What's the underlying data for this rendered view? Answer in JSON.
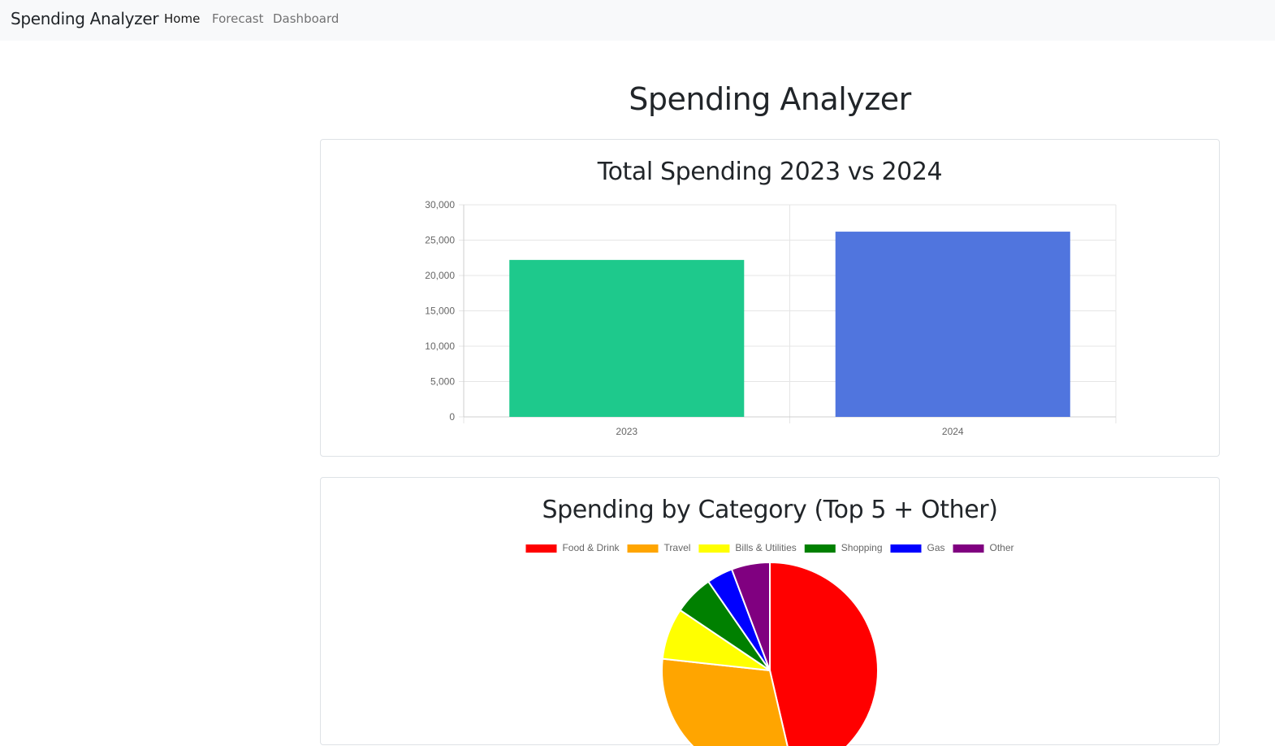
{
  "navbar": {
    "brand": "Spending Analyzer",
    "links": [
      {
        "label": "Home",
        "active": true
      },
      {
        "label": "Forecast",
        "active": false
      },
      {
        "label": "Dashboard",
        "active": false
      }
    ]
  },
  "page": {
    "title": "Spending Analyzer"
  },
  "chart_data": [
    {
      "type": "bar",
      "title": "Total Spending 2023 vs 2024",
      "categories": [
        "2023",
        "2024"
      ],
      "values": [
        22200,
        26200
      ],
      "colors": [
        "#1ec98c",
        "#5075de"
      ],
      "ylim": [
        0,
        30000
      ],
      "yticks": [
        "0",
        "5,000",
        "10,000",
        "15,000",
        "20,000",
        "25,000",
        "30,000"
      ],
      "ytick_values": [
        0,
        5000,
        10000,
        15000,
        20000,
        25000,
        30000
      ],
      "grid": true,
      "legend": "none"
    },
    {
      "type": "pie",
      "title": "Spending by Category (Top 5 + Other)",
      "labels": [
        "Food & Drink",
        "Travel",
        "Bills & Utilities",
        "Shopping",
        "Gas",
        "Other"
      ],
      "values": [
        45.2,
        29.6,
        7.5,
        5.8,
        3.8,
        5.6
      ],
      "colors": [
        "#ff0000",
        "#ffa500",
        "#ffff00",
        "#008000",
        "#0000ff",
        "#800080"
      ],
      "legend": "top"
    }
  ]
}
